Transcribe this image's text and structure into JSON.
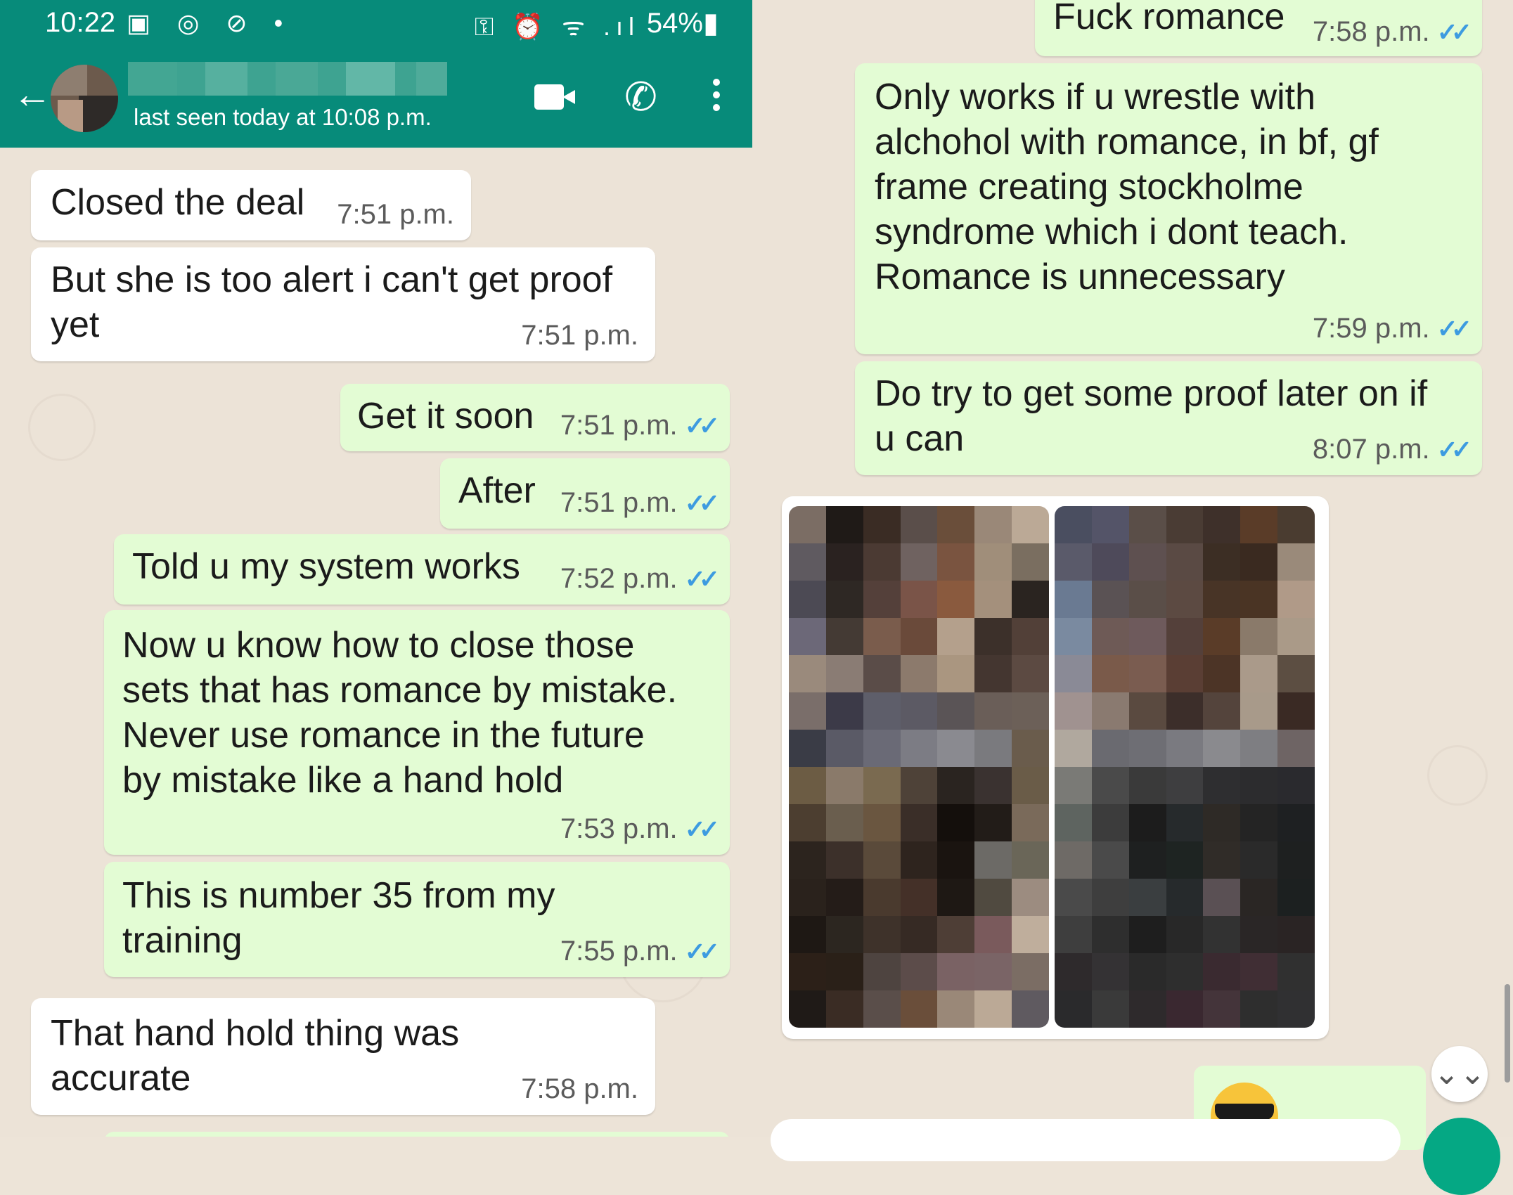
{
  "status_bar": {
    "time": "10:22",
    "icons": "▣ ◎ ⊘ •",
    "system_icons": "⚿ ⏰ ᯤ .ıl",
    "battery": "54%▮"
  },
  "header": {
    "contact_name": "",
    "last_seen": "last seen today at 10:08 p.m.",
    "back_icon": "←",
    "video_icon": "video-call-icon",
    "phone_icon": "✆",
    "menu_icon": "more-vert-icon"
  },
  "left_messages": [
    {
      "text": "Closed the deal",
      "time": "7:51 p.m."
    },
    {
      "text": "But she is too alert i can't get proof\nyet",
      "time": "7:51 p.m."
    },
    {
      "text": "Get it soon",
      "time": "7:51 p.m.",
      "tick": "✓✓"
    },
    {
      "text": "After",
      "time": "7:51 p.m.",
      "tick": "✓✓"
    },
    {
      "text": "Told u my system works",
      "time": "7:52 p.m.",
      "tick": "✓✓"
    },
    {
      "text": "Now u know how to close those\nsets that has romance by mistake.\nNever use romance in the future\nby mistake like a hand hold",
      "time": "7:53 p.m.",
      "tick": "✓✓"
    },
    {
      "text": "This is number 35 from my\ntraining",
      "time": "7:55 p.m.",
      "tick": "✓✓"
    },
    {
      "text": "That hand hold thing was\naccurate",
      "time": "7:58 p.m."
    }
  ],
  "right_messages": [
    {
      "text": "Fuck romance",
      "time": "7:58 p.m.",
      "tick": "✓✓"
    },
    {
      "text": "Only works if u wrestle with\nalchohol with romance, in bf, gf\nframe creating stockholme\nsyndrome which i dont teach.\nRomance is unnecessary",
      "time": "7:59 p.m.",
      "tick": "✓✓"
    },
    {
      "text": "Do try to get some proof later on if\nu can",
      "time": "8:07 p.m.",
      "tick": "✓✓"
    }
  ],
  "scroll_down_icon": "⌄⌄",
  "colors": {
    "header": "#078b7a",
    "incoming": "#ffffff",
    "outgoing": "#e3fcd4",
    "tick": "#3d9be0",
    "wallpaper": "#ece3d7"
  }
}
